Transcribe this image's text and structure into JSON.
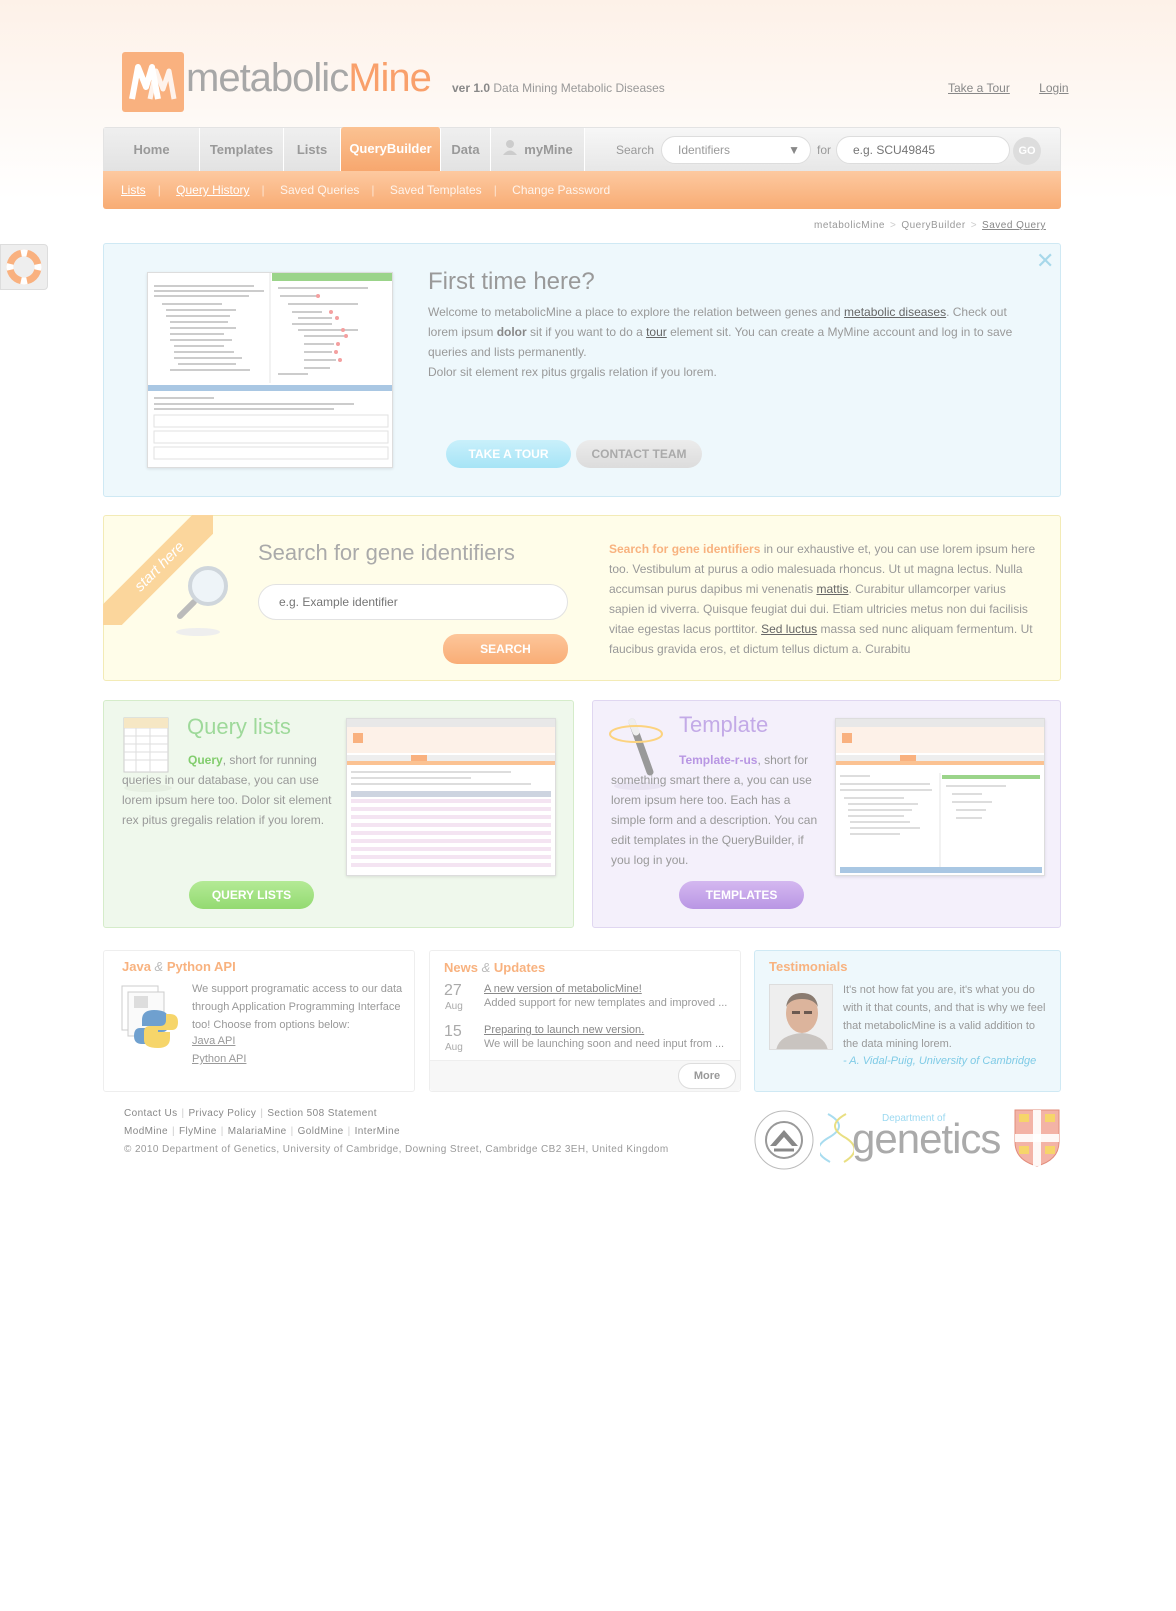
{
  "header": {
    "brand_main": "metabolic",
    "brand_accent": "Mine",
    "version": "ver 1.0",
    "tagline": "Data Mining Metabolic Diseases",
    "links": [
      "Take a Tour",
      "Login"
    ]
  },
  "nav": {
    "tabs": [
      {
        "label": "Home"
      },
      {
        "label": "Templates"
      },
      {
        "label": "Lists"
      },
      {
        "label": "QueryBuilder",
        "active": true
      },
      {
        "label": "Data"
      },
      {
        "label": "myMine"
      }
    ],
    "search_label": "Search",
    "search_select_value": "Identifiers",
    "for_label": "for",
    "search_placeholder": "e.g. SCU49845",
    "go_label": "GO"
  },
  "subnav": {
    "items": [
      "Lists",
      "Query History",
      "Saved Queries",
      "Saved Templates",
      "Change Password"
    ]
  },
  "breadcrumb": [
    "metabolicMine",
    "QueryBuilder",
    "Saved Query"
  ],
  "first_time": {
    "title": "First time here?",
    "p1_a": "Welcome to metabolicMine a place to explore the relation between genes and ",
    "p1_link": "metabolic diseases",
    "p1_b": ". Check out lorem ipsum ",
    "p1_bold": "dolor",
    "p1_c": " sit if you want to do a ",
    "p1_link2": "tour",
    "p1_d": " element sit. You can create a MyMine account and log in to save queries and lists permanently.",
    "p2": "Dolor sit element rex pitus grgalis relation if you lorem.",
    "take_tour": "TAKE A TOUR",
    "contact": "CONTACT TEAM",
    "close": "✕"
  },
  "gene_search": {
    "ribbon": "start here",
    "title": "Search for gene identifiers",
    "placeholder": "e.g. Example identifier",
    "button": "SEARCH",
    "text_hl": "Search for gene identifiers",
    "text_a": " in our exhaustive et, you can use lorem ipsum here too. Vestibulum at purus a odio malesuada rhoncus. Ut ut magna lectus. Nulla accumsan purus dapibus mi venenatis ",
    "text_link1": "mattis",
    "text_b": ". Curabitur ullamcorper varius sapien id viverra. Quisque feugiat dui dui. Etiam ultricies metus non dui facilisis vitae egestas lacus porttitor. ",
    "text_link2": "Sed luctus",
    "text_c": " massa sed nunc aliquam fermentum. Ut faucibus gravida eros, et dictum tellus dictum a. Curabitu"
  },
  "query_lists": {
    "title": "Query lists",
    "hl": "Query",
    "text": ", short for running queries in our database, you can use lorem ipsum here too. Dolor sit element  rex pitus gregalis relation if you  lorem.",
    "button": "QUERY LISTS"
  },
  "template": {
    "title": "Template",
    "hl": "Template-r-us",
    "text": ", short for something smart there a, you can use lorem ipsum here too. Each has a simple form and a description. You can edit templates in the QueryBuilder, if you log in you.",
    "button": "TEMPLATES"
  },
  "api": {
    "title_a": "Java",
    "title_amp": "&",
    "title_b": "Python API",
    "text": "We support programatic access to our data through Application Programming Interface too! Choose from options below:",
    "links": [
      "Java API",
      "Python API"
    ]
  },
  "news": {
    "title_a": "News",
    "title_amp": "&",
    "title_b": "Updates",
    "items": [
      {
        "day": "27",
        "month": "Aug",
        "headline": "A new version of metabolicMine!",
        "text": "Added support for new templates and improved ..."
      },
      {
        "day": "15",
        "month": "Aug",
        "headline": "Preparing to launch new version.",
        "text": "We will be launching soon and need input from ..."
      }
    ],
    "more": "More"
  },
  "testimonials": {
    "title": "Testimonials",
    "quote": "It's not how fat you are, it's what you do with it that counts, and that is why we feel that metabolicMine is a valid addition to the data mining lorem.",
    "author": "- A. Vidal-Puig, University of Cambridge"
  },
  "footer": {
    "links1": [
      "Contact Us",
      "Privacy Policy",
      "Section 508 Statement"
    ],
    "links2": [
      "ModMine",
      "FlyMine",
      "MalariaMine",
      "GoldMine",
      "InterMine"
    ],
    "copyright": "© 2010 Department of Genetics, University of Cambridge, Downing Street, Cambridge CB2 3EH, United Kingdom",
    "genetics_dept": "Department of",
    "genetics_word": "genetics"
  },
  "colors": {
    "accent": "#f9a06b",
    "blue_box": "#eef8fc",
    "yellow_box": "#fffde9",
    "green_box": "#eff8ec",
    "purple_box": "#f4f0fb"
  }
}
